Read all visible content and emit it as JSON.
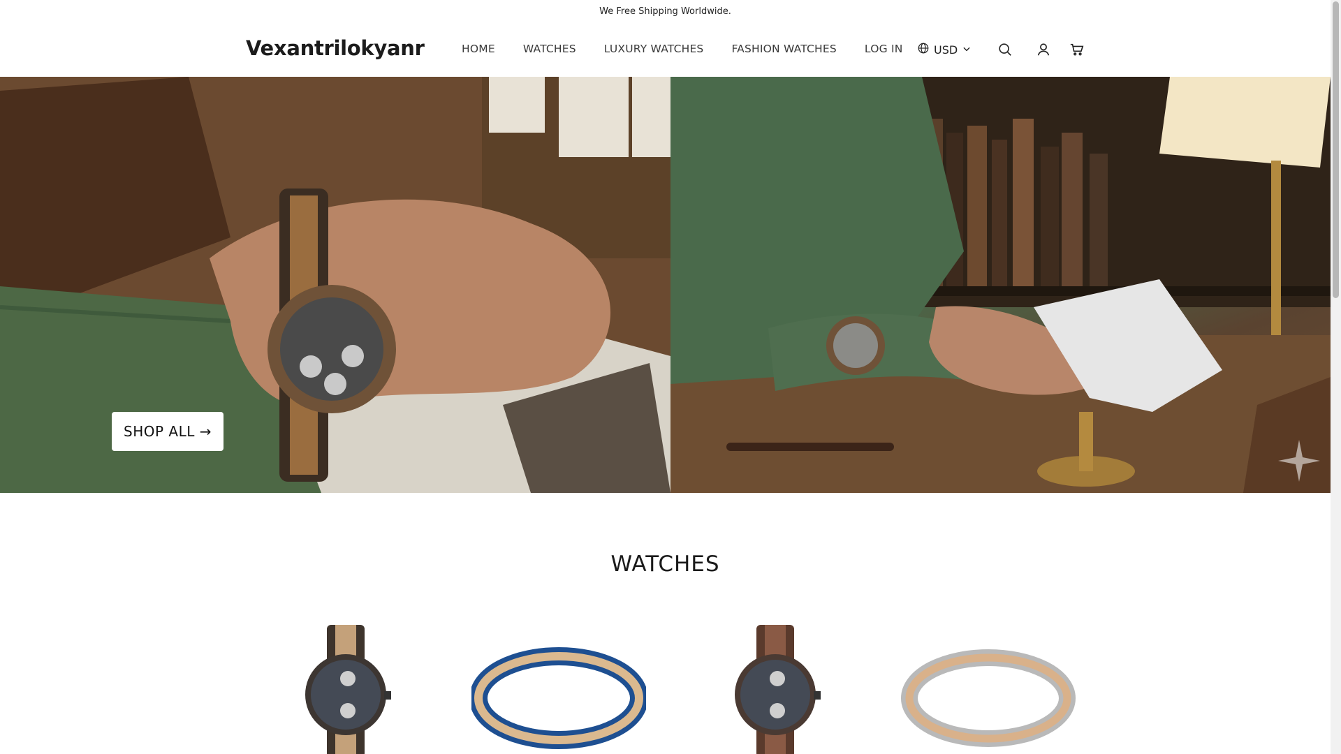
{
  "announcement": {
    "text": "We Free Shipping Worldwide."
  },
  "header": {
    "logo": "Vexantrilokyanr",
    "nav": [
      {
        "label": "HOME"
      },
      {
        "label": "WATCHES"
      },
      {
        "label": "LUXURY WATCHES"
      },
      {
        "label": "FASHION WATCHES"
      },
      {
        "label": "LOG IN"
      }
    ],
    "currency": "USD",
    "icons": [
      "globe-icon",
      "chevron-down-icon",
      "search-icon",
      "account-icon",
      "cart-icon"
    ]
  },
  "hero": {
    "cta_label": "SHOP ALL →"
  },
  "collection": {
    "title": "WATCHES",
    "products": [
      {
        "type": "chronograph watch",
        "band": "wood"
      },
      {
        "type": "bracelet",
        "band": "blue and wood"
      },
      {
        "type": "chronograph watch",
        "band": "rosewood"
      },
      {
        "type": "bracelet",
        "band": "silver and wood"
      }
    ]
  },
  "colors": {
    "text": "#1a1a1a",
    "background": "#ffffff",
    "sweater_green": "#4d6845",
    "wood_brown": "#6b4a30"
  }
}
